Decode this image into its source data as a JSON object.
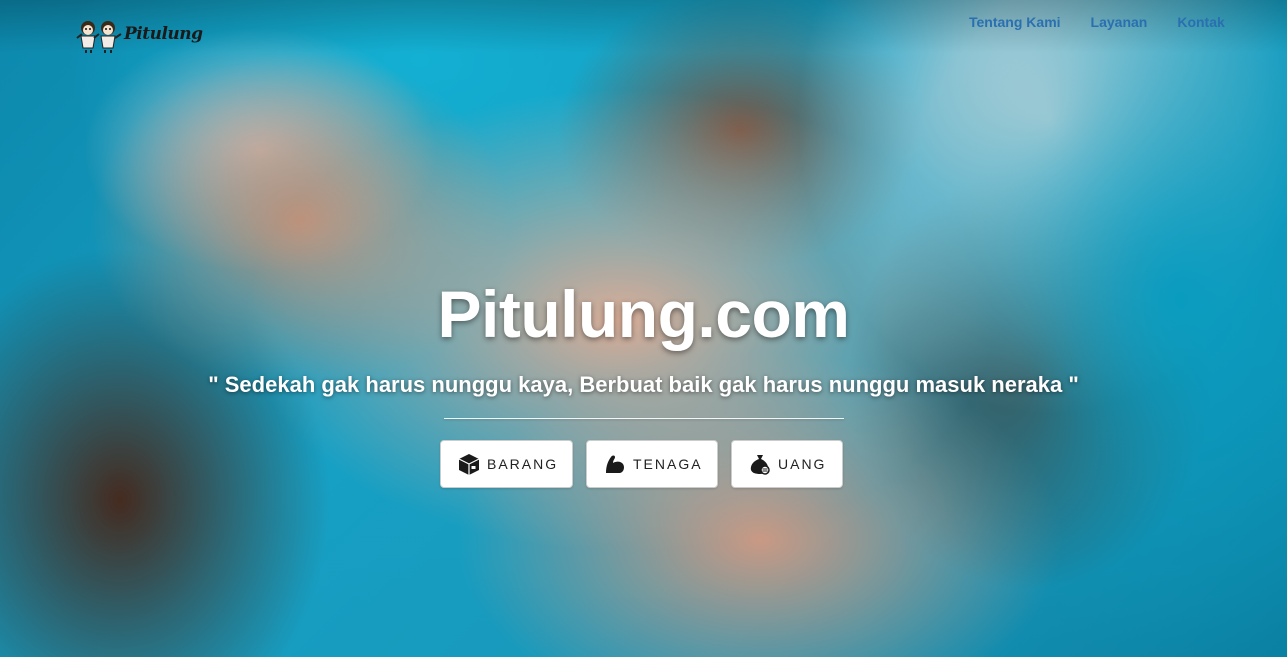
{
  "navbar": {
    "brand": "Pitulung",
    "links": [
      {
        "label": "Tentang Kami"
      },
      {
        "label": "Layanan"
      },
      {
        "label": "Kontak"
      }
    ]
  },
  "hero": {
    "title": "Pitulung.com",
    "tagline": "\" Sedekah gak harus nunggu kaya, Berbuat baik gak harus nunggu masuk neraka \"",
    "buttons": [
      {
        "label": "BARANG",
        "icon": "box-icon"
      },
      {
        "label": "TENAGA",
        "icon": "flexed-arm-icon"
      },
      {
        "label": "UANG",
        "icon": "money-bag-icon"
      }
    ]
  },
  "colors": {
    "nav_link": "#2a6fb0",
    "hero_text": "#ffffff",
    "button_bg": "#ffffff",
    "button_text": "#222222"
  }
}
